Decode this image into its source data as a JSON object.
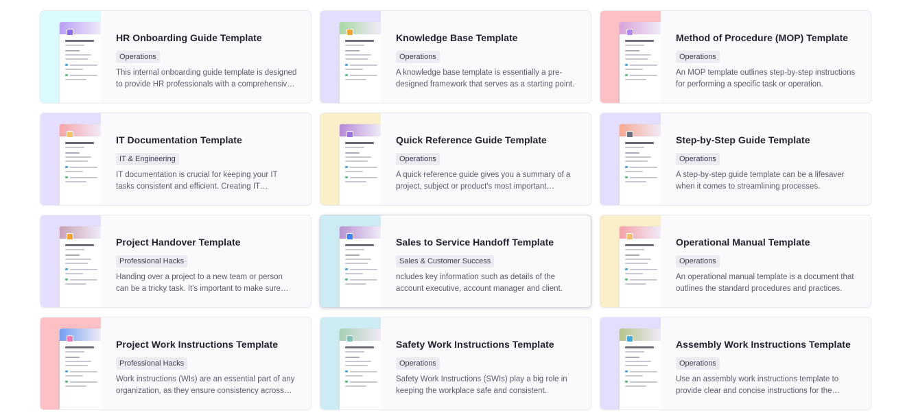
{
  "templates": [
    {
      "title": "HR Onboarding Guide Template",
      "category": "Operations",
      "description": "This internal onboarding guide template is designed to provide HR professionals with a comprehensive resource.",
      "bg": "#dafafd",
      "cover": "#b99ef5",
      "icon": "#8b6ef0",
      "doc_title": "HR Onboarding Guide",
      "icon_name": "phone-icon"
    },
    {
      "title": "Knowledge Base Template",
      "category": "Operations",
      "description": "A knowledge base template is essentially a pre-designed framework that serves as a starting point.",
      "bg": "#e4defd",
      "cover": "#a9d7a4",
      "icon": "#f1a232",
      "doc_title": "Knowledge Base",
      "icon_name": "book-icon"
    },
    {
      "title": "Method of Procedure (MOP) Template",
      "category": "Operations",
      "description": "An MOP template outlines step-by-step instructions for performing a specific task or operation.",
      "bg": "#fdc0c4",
      "cover": "#d9a2d8",
      "icon": "#b486f0",
      "doc_title": "Method of Procedure",
      "icon_name": "checklist-icon"
    },
    {
      "title": "IT Documentation Template",
      "category": "IT & Engineering",
      "description": "IT documentation is crucial for keeping your IT tasks consistent and efficient. Creating IT documentation helps.",
      "bg": "#e6defd",
      "cover": "#f6a3a8",
      "icon": "#f4c66b",
      "doc_title": "IT Documentation",
      "icon_name": "server-icon"
    },
    {
      "title": "Quick Reference Guide Template",
      "category": "Operations",
      "description": "A quick reference guide gives you a summary of a project, subject or product's most important information.",
      "bg": "#faefc8",
      "cover": "#b58ad8",
      "icon": "#9b74e0",
      "doc_title": "Quick Reference Guide",
      "icon_name": "bookmark-icon"
    },
    {
      "title": "Step-by-Step Guide Template",
      "category": "Operations",
      "description": "A step-by-step guide template can be a lifesaver when it comes to streamlining processes.",
      "bg": "#e4defd",
      "cover": "#f6a890",
      "icon": "#6b7080",
      "doc_title": "Step-by-Step Guide",
      "icon_name": "steps-icon"
    },
    {
      "title": "Project Handover Template",
      "category": "Professional Hacks",
      "description": "Handing over a project to a new team or person can be a tricky task. It's important to make sure nothing is missed.",
      "bg": "#e6defd",
      "cover": "#c9a2b8",
      "icon": "#f4a530",
      "doc_title": "Project Handover",
      "icon_name": "handshake-icon"
    },
    {
      "title": "Sales to Service Handoff Template",
      "category": "Sales & Customer Success",
      "description": "ncludes key information such as details of the account executive, account manager and client.",
      "bg": "#ccebf3",
      "cover": "#b892d2",
      "icon": "#3b82f6",
      "doc_title": "Sales to Service Handoff",
      "icon_name": "transfer-icon"
    },
    {
      "title": "Operational Manual Template",
      "category": "Operations",
      "description": "An operational manual template is a document that outlines the standard procedures and practices.",
      "bg": "#faefc8",
      "cover": "#f5a3a7",
      "icon": "#f4c070",
      "doc_title": "Operational Manual",
      "icon_name": "manual-icon"
    },
    {
      "title": "Project Work Instructions Template",
      "category": "Professional Hacks",
      "description": "Work instructions (WIs) are an essential part of any organization, as they ensure consistency across teams.",
      "bg": "#fdc0c4",
      "cover": "#6fa0f2",
      "icon": "#f07ab8",
      "doc_title": "Project Work Instructions",
      "icon_name": "clipboard-icon"
    },
    {
      "title": "Safety Work Instructions Template",
      "category": "Operations",
      "description": "Safety Work Instructions (SWIs) play a big role in keeping the workplace safe and consistent.",
      "bg": "#ccebf3",
      "cover": "#a8d0b2",
      "icon": "#7fc2b8",
      "doc_title": "Safety Work Instructions",
      "icon_name": "shield-icon"
    },
    {
      "title": "Assembly Work Instructions Template",
      "category": "Operations",
      "description": "Use an assembly work instructions template to provide clear and concise instructions for the assembly process.",
      "bg": "#e4defd",
      "cover": "#b4c58a",
      "icon": "#46a7d6",
      "doc_title": "Assembly Work Instructions",
      "icon_name": "wrench-icon"
    }
  ],
  "active_index": 7
}
